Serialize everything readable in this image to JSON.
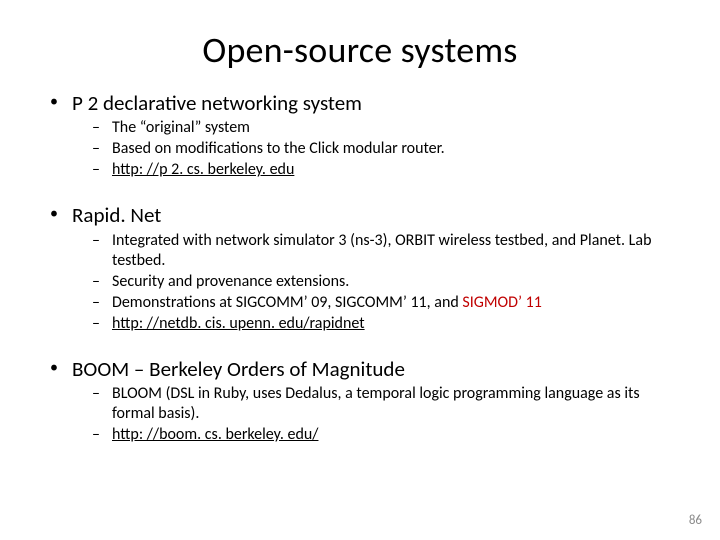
{
  "title": "Open-source systems",
  "sections": [
    {
      "heading": "P 2 declarative networking system",
      "items": [
        {
          "segments": [
            {
              "text": "The “original” system"
            }
          ]
        },
        {
          "segments": [
            {
              "text": "Based on modifications to the Click modular router."
            }
          ]
        },
        {
          "segments": [
            {
              "text": "http: //p 2. cs. berkeley. edu",
              "link": true
            }
          ]
        }
      ]
    },
    {
      "heading": "Rapid. Net",
      "items": [
        {
          "segments": [
            {
              "text": "Integrated with network simulator 3 (ns-3), ORBIT wireless testbed, and Planet. Lab testbed."
            }
          ]
        },
        {
          "segments": [
            {
              "text": "Security and provenance extensions."
            }
          ]
        },
        {
          "segments": [
            {
              "text": "Demonstrations at SIGCOMM’ 09, SIGCOMM’ 11, and "
            },
            {
              "text": "SIGMOD’ 11",
              "red": true
            }
          ]
        },
        {
          "segments": [
            {
              "text": "http: //netdb. cis. upenn. edu/rapidnet",
              "link": true
            }
          ]
        }
      ]
    },
    {
      "heading": "BOOM – Berkeley Orders of Magnitude",
      "items": [
        {
          "segments": [
            {
              "text": "BLOOM (DSL in Ruby, uses Dedalus, a temporal logic programming language as its formal basis)."
            }
          ]
        },
        {
          "segments": [
            {
              "text": "http: //boom. cs. berkeley. edu/",
              "link": true
            }
          ]
        }
      ]
    }
  ],
  "page_number": "86"
}
